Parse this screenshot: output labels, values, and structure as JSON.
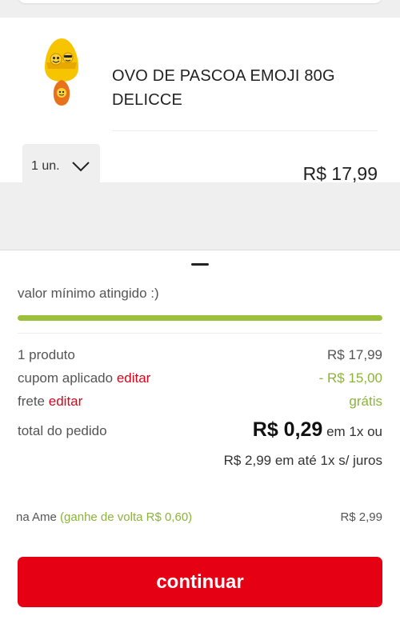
{
  "product": {
    "name": "OVO DE PASCOA EMOJI 80G DELICCE",
    "quantity": "1 un.",
    "price": "R$ 17,99",
    "image_icon": "easter-egg-emoji-icon"
  },
  "summary": {
    "minimum_label": "valor mínimo atingido :)",
    "progress_percent": 100,
    "items_label": "1 produto",
    "items_value": "R$ 17,99",
    "coupon_label": "cupom aplicado",
    "coupon_edit": "editar",
    "coupon_value": "- R$ 15,00",
    "shipping_label": "frete",
    "shipping_edit": "editar",
    "shipping_value": "grátis",
    "total_label": "total do pedido",
    "total_value": "R$ 0,29",
    "total_suffix": "em 1x ou",
    "installments": "R$ 2,99 em até 1x s/ juros",
    "ame_label": "na Ame",
    "ame_cashback": "(ganhe de volta R$ 0,60)",
    "ame_value": "R$ 2,99"
  },
  "actions": {
    "continue_label": "continuar"
  },
  "colors": {
    "accent_red": "#e60014",
    "link_red": "#d3071c",
    "green": "#8cb33a",
    "progress_green": "#9bc13c"
  }
}
